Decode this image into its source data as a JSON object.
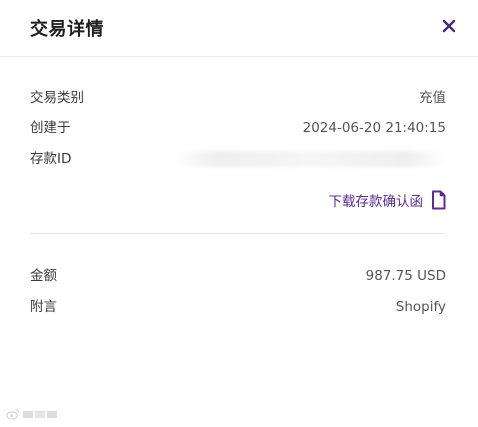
{
  "dialog": {
    "title": "交易详情",
    "close_icon": "close-icon"
  },
  "details": {
    "type_label": "交易类别",
    "type_value": "充值",
    "created_label": "创建于",
    "created_value": "2024-06-20 21:40:15",
    "deposit_id_label": "存款ID",
    "deposit_id_value": ""
  },
  "download": {
    "label": "下载存款确认函",
    "icon": "document-icon"
  },
  "summary": {
    "amount_label": "金额",
    "amount_value": "987.75 USD",
    "note_label": "附言",
    "note_value": "Shopify"
  },
  "watermark": {
    "icon": "weibo-icon"
  },
  "colors": {
    "accent": "#5b2d90",
    "close": "#4a2a78",
    "divider": "#e4e4e4",
    "title": "#1f1f1f"
  }
}
